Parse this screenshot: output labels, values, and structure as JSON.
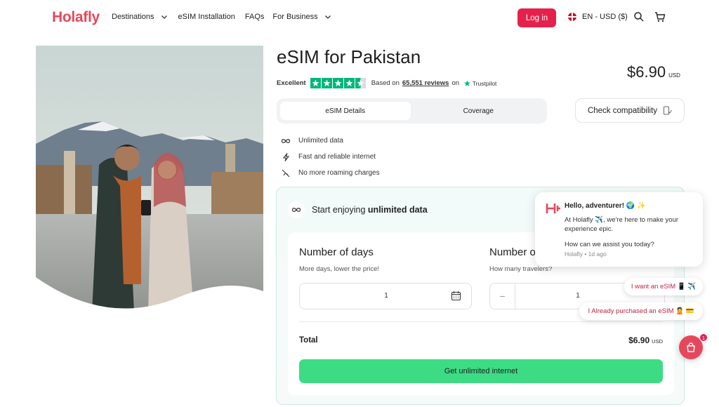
{
  "header": {
    "logo": "Holafly",
    "nav": [
      {
        "label": "Destinations",
        "dropdown": true
      },
      {
        "label": "eSIM Installation",
        "dropdown": false
      },
      {
        "label": "FAQs",
        "dropdown": false
      },
      {
        "label": "For Business",
        "dropdown": true
      }
    ],
    "login_label": "Log in",
    "locale_label": "EN - USD ($)"
  },
  "product": {
    "title": "eSIM for Pakistan",
    "price": "$6.90",
    "currency": "USD",
    "rating": {
      "label": "Excellent",
      "stars": 4.5,
      "based_on": "Based on",
      "reviews": "65,551 reviews",
      "on": "on",
      "provider": "Trustpilot"
    },
    "tabs": [
      "eSIM Details",
      "Coverage"
    ],
    "active_tab": "eSIM Details",
    "check_compat_label": "Check compatibility",
    "features": [
      {
        "icon": "infinity-icon",
        "label": "Unlimited data"
      },
      {
        "icon": "lightning-icon",
        "label": "Fast and reliable internet"
      },
      {
        "icon": "no-roaming-icon",
        "label": "No more roaming charges"
      }
    ]
  },
  "booking": {
    "heading_prefix": "Start enjoying ",
    "heading_strong": "unlimited data",
    "days_title": "Number of days",
    "days_subtitle": "More days, lower the price!",
    "days_value": "1",
    "travelers_title": "Number o",
    "travelers_subtitle": "How many travelers?",
    "travelers_value": "1",
    "total_label": "Total",
    "total_value": "$6.90",
    "total_currency": "USD",
    "cta_label": "Get unlimited internet"
  },
  "chat": {
    "hello": "Hello, adventurer! 🌍 ✨",
    "body": "At Holafly ✈️, we're here to make your experience epic.",
    "question": "How can we assist you today?",
    "meta": "Holafly • 1d ago",
    "chip_1": "I want an eSIM 📱 ✈️",
    "chip_2": "I Already purchased an eSIM 🙎 💳",
    "badge_count": "1"
  },
  "colors": {
    "brand": "#e5214b",
    "cta": "#3ddc84",
    "trustpilot": "#00b67a"
  }
}
